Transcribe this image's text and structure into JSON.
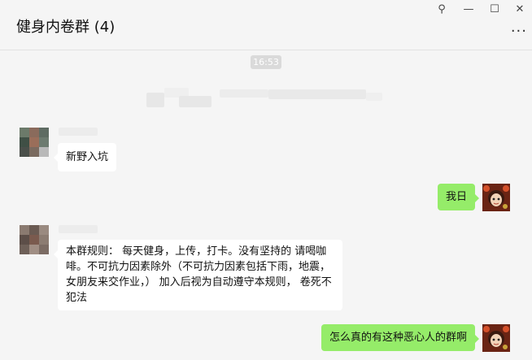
{
  "window": {
    "title": "健身内卷群 (4)",
    "controls": {
      "pin": "⚲",
      "minimize": "—",
      "maximize": "☐",
      "close": "✕"
    },
    "more": "···"
  },
  "chat": {
    "timestamp": "16:53",
    "messages": [
      {
        "side": "left",
        "text": "新野入坑"
      },
      {
        "side": "right",
        "text": "我日"
      },
      {
        "side": "left",
        "text": "本群规则： 每天健身，上传，打卡。没有坚持的 请喝咖啡。不可抗力因素除外（不可抗力因素包括下雨，地震，女朋友来交作业，） 加入后视为自动遵守本规则，  卷死不犯法"
      },
      {
        "side": "right",
        "text": "怎么真的有这种恶心人的群啊"
      }
    ]
  },
  "colors": {
    "self_bubble": "#95ec69",
    "other_bubble": "#ffffff",
    "background": "#f5f5f5"
  }
}
